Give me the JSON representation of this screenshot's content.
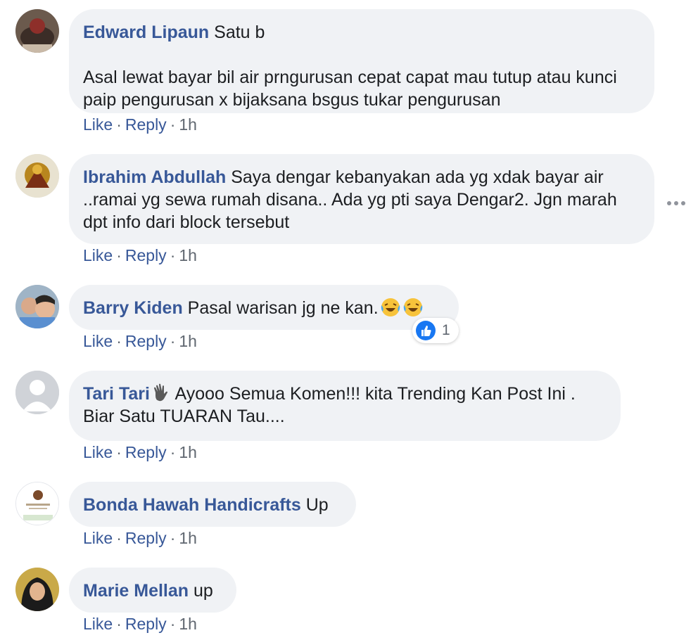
{
  "comments": [
    {
      "author": "Edward Lipaun",
      "text": "Satu b\n\nAsal lewat bayar bil air prngurusan cepat capat mau tutup atau kunci paip pengurusan x bijaksana bsgus tukar pengurusan",
      "like": "Like",
      "reply": "Reply",
      "time": "1h",
      "sep": "·"
    },
    {
      "author": "Ibrahim Abdullah",
      "text": "Saya dengar kebanyakan ada yg xdak bayar air ..ramai yg sewa rumah disana.. Ada yg pti saya Dengar2. Jgn marah dpt info dari block tersebut",
      "like": "Like",
      "reply": "Reply",
      "time": "1h",
      "sep": "·"
    },
    {
      "author": "Barry Kiden",
      "text": "Pasal warisan jg ne kan.",
      "emojis": [
        "laughing-tears-emoji",
        "laughing-tears-emoji"
      ],
      "reaction_count": "1",
      "like": "Like",
      "reply": "Reply",
      "time": "1h",
      "sep": "·"
    },
    {
      "author": "Tari Tari",
      "text": "Ayooo Semua Komen!!! kita Trending Kan Post Ini . Biar Satu TUARAN Tau....",
      "author_icon": "waving-hand-icon",
      "like": "Like",
      "reply": "Reply",
      "time": "1h",
      "sep": "·"
    },
    {
      "author": "Bonda Hawah Handicrafts",
      "text": "Up",
      "like": "Like",
      "reply": "Reply",
      "time": "1h",
      "sep": "·"
    },
    {
      "author": "Marie Mellan",
      "text": "up",
      "like": "Like",
      "reply": "Reply",
      "time": "1h",
      "sep": "·"
    }
  ],
  "colors": {
    "bubble": "#f0f2f5",
    "author": "#385898",
    "meta": "#606770",
    "like_blue": "#1877f2"
  },
  "icons": {
    "more_options": "more-horizontal-icon",
    "reaction": "like-thumb-icon"
  }
}
